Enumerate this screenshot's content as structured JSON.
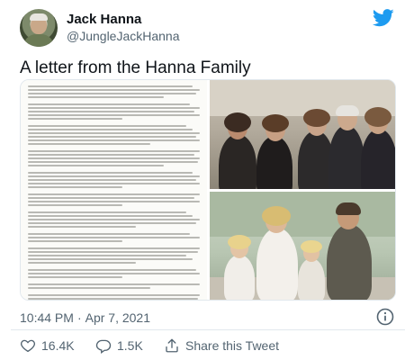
{
  "author": {
    "display_name": "Jack Hanna",
    "handle": "@JungleJackHanna"
  },
  "tweet": {
    "text": "A letter from the Hanna Family",
    "time": "10:44 PM",
    "separator": "·",
    "date": "Apr 7, 2021"
  },
  "actions": {
    "like_count": "16.4K",
    "reply_count": "1.5K",
    "share_label": "Share this Tweet"
  },
  "icons": {
    "brand": "twitter-bird-icon",
    "info": "info-icon",
    "like": "heart-icon",
    "reply": "reply-icon",
    "share": "share-icon"
  },
  "colors": {
    "twitter_blue": "#1d9bf0",
    "text_primary": "#0f1419",
    "text_secondary": "#536471",
    "divider": "#e1e8ed"
  }
}
